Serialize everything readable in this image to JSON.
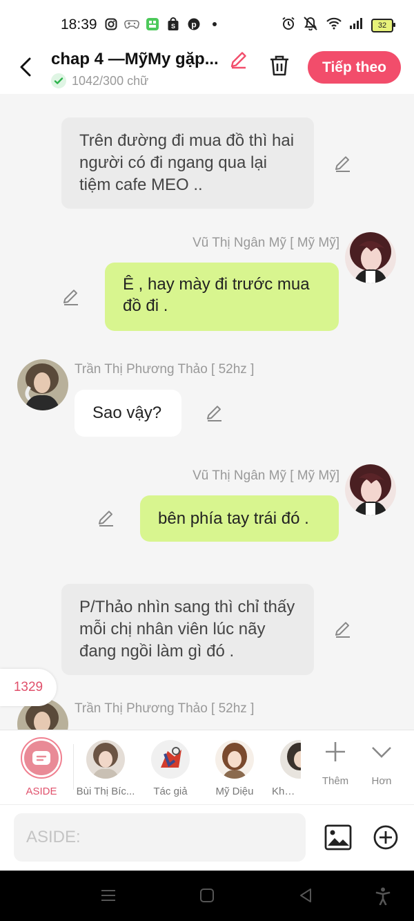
{
  "status": {
    "time": "18:39",
    "battery": "32"
  },
  "header": {
    "title": "chap 4 —MỹMy gặp...",
    "word_count": "1042/300 chữ",
    "next_label": "Tiếp theo"
  },
  "chat": {
    "narration1": "Trên đường đi mua đồ thì hai người có đi ngang qua lại tiệm cafe MEO ..",
    "msg1_name": "Vũ Thị Ngân Mỹ [ Mỹ Mỹ]",
    "msg1_text": "Ê , hay mày đi trước mua đồ đi .",
    "msg2_name": "Trần Thị Phương Thảo [ 52hz ]",
    "msg2_text": "Sao vậy?",
    "msg3_name": "Vũ Thị Ngân Mỹ [ Mỹ Mỹ]",
    "msg3_text": "bên phía tay trái đó .",
    "narration2": "P/Thảo nhìn sang thì chỉ thấy mỗi chị nhân viên lúc nãy đang ngồi làm gì đó .",
    "msg4_name": "Trần Thị Phương Thảo [ 52hz ]",
    "counter": "1329"
  },
  "characters": [
    {
      "label": "ASIDE"
    },
    {
      "label": "Bùi Thị Bíc..."
    },
    {
      "label": "Tác giả"
    },
    {
      "label": "Mỹ Diệu"
    },
    {
      "label": "Khươn"
    }
  ],
  "more_label": "Thêm",
  "less_label": "Hơn",
  "input": {
    "placeholder": "ASIDE:"
  },
  "colors": {
    "accent": "#f24d6b",
    "bubble_self": "#d8f58f",
    "narration_bg": "#ebebeb"
  }
}
